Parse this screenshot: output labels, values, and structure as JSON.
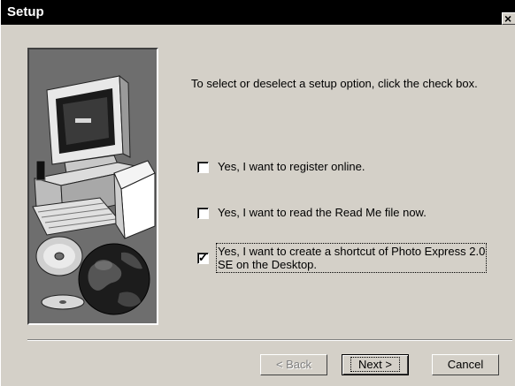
{
  "window": {
    "title": "Setup",
    "close_glyph": "×"
  },
  "illustration": {
    "icons": [
      "computer-icon",
      "cd-discs-icon",
      "globe-icon"
    ]
  },
  "instruction": "To select or deselect a setup option, click the check box.",
  "options": [
    {
      "label": "Yes, I want to register online.",
      "checked": false
    },
    {
      "label": "Yes, I want to read the Read Me file now.",
      "checked": false
    },
    {
      "label_line1": "Yes, I want to create a shortcut of Photo Express 2.0",
      "label_line2": "SE on the Desktop.",
      "checked": true,
      "check_glyph": "✓"
    }
  ],
  "buttons": {
    "back": "< Back",
    "next": "Next >",
    "cancel": "Cancel"
  },
  "colors": {
    "titlebar": "#000000",
    "dialog": "#d4d0c8",
    "art_panel": "#6e6e6e"
  }
}
